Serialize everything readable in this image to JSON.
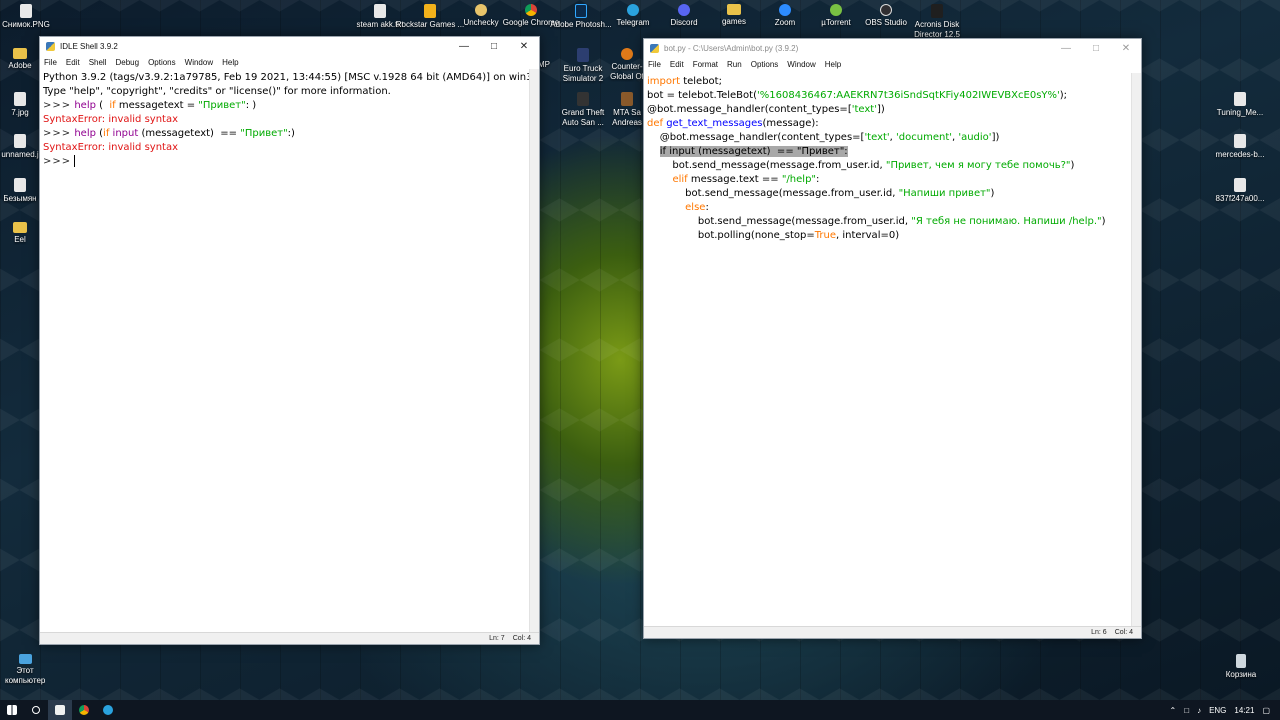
{
  "desktop_top": [
    {
      "label": "Снимок.PNG"
    },
    {
      "label": "steam akk.txt"
    },
    {
      "label": "Rockstar Games ..."
    },
    {
      "label": "Unchecky"
    },
    {
      "label": "Google Chrome"
    },
    {
      "label": "Adobe Photosh..."
    },
    {
      "label": "Telegram"
    },
    {
      "label": "Discord"
    },
    {
      "label": "games"
    },
    {
      "label": "Zoom"
    },
    {
      "label": "µTorrent"
    },
    {
      "label": "OBS Studio"
    },
    {
      "label": "Acronis Disk Director 12.5"
    }
  ],
  "desktop_left": [
    {
      "label": "Adobe"
    },
    {
      "label": "7.jpg"
    },
    {
      "label": "unnamed.j"
    },
    {
      "label": "Безымян"
    },
    {
      "label": "Eel"
    }
  ],
  "desktop_mid": [
    {
      "label": "MP"
    },
    {
      "label": "Euro Truck Simulator 2"
    },
    {
      "label": "Counter- Global Of"
    },
    {
      "label": "Grand Theft Auto San ..."
    },
    {
      "label": "MTA Sa Andreas"
    }
  ],
  "desktop_right": [
    {
      "label": "Tuning_Me..."
    },
    {
      "label": "mercedes-b..."
    },
    {
      "label": "837f247a00..."
    }
  ],
  "desktop_bottom": {
    "this_pc": "Этот компьютер",
    "recycle": "Корзина"
  },
  "shell": {
    "title": "IDLE Shell 3.9.2",
    "menu": [
      "File",
      "Edit",
      "Shell",
      "Debug",
      "Options",
      "Window",
      "Help"
    ],
    "banner1": "Python 3.9.2 (tags/v3.9.2:1a79785, Feb 19 2021, 13:44:55) [MSC v.1928 64 bit (AMD64)] on win32",
    "banner2": "Type \"help\", \"copyright\", \"credits\" or \"license()\" for more information.",
    "prompt": ">>>",
    "cmd1_a": "help",
    "cmd1_b": " (  ",
    "cmd1_c": "if",
    "cmd1_d": " messagetext = ",
    "cmd1_e": "\"Привет\"",
    "cmd1_f": ": )",
    "err_name": "SyntaxError",
    "err_msg": ": invalid syntax",
    "cmd2_a": "help",
    "cmd2_b": " (",
    "cmd2_c": "if",
    "cmd2_d": " ",
    "cmd2_e": "input",
    "cmd2_f": " (messagetext)  == ",
    "cmd2_g": "\"Привет\"",
    "cmd2_h": ":)",
    "status_ln": "Ln: 7",
    "status_col": "Col: 4"
  },
  "editor": {
    "title": "bot.py - C:\\Users\\Admin\\bot.py (3.9.2)",
    "menu": [
      "File",
      "Edit",
      "Format",
      "Run",
      "Options",
      "Window",
      "Help"
    ],
    "l1_kw": "import",
    "l1_rest": " telebot;",
    "l2_a": "bot = telebot.TeleBot(",
    "l2_str": "'%1608436467:AAEKRN7t36iSndSqtKFiy402IWEVBXcE0sY%'",
    "l2_b": ");",
    "l3_a": "@bot.message_handler(content_types=[",
    "l3_str": "'text'",
    "l3_b": "])",
    "l4_kw": "def",
    "l4_def": " get_text_messages",
    "l4_rest": "(message):",
    "l5_a": "    @bot.message_handler(content_types=[",
    "l5_s1": "'text'",
    "l5_c1": ", ",
    "l5_s2": "'document'",
    "l5_c2": ", ",
    "l5_s3": "'audio'",
    "l5_b": "])",
    "l6_indent": "    ",
    "l6_hl": "if input (messagetext)  == \"Привет\":",
    "l7_a": "        bot.send_message(message.from_user.id, ",
    "l7_str": "\"Привет, чем я могу тебе помочь?\"",
    "l7_b": ")",
    "l8_indent": "        ",
    "l8_kw": "elif",
    "l8_a": " message.text == ",
    "l8_str": "\"/help\"",
    "l8_b": ":",
    "l9_a": "            bot.send_message(message.from_user.id, ",
    "l9_str": "\"Напиши привет\"",
    "l9_b": ")",
    "l10_indent": "            ",
    "l10_kw": "else",
    "l10_b": ":",
    "l11_a": "                bot.send_message(message.from_user.id, ",
    "l11_str": "\"Я тебя не понимаю. Напиши /help.\"",
    "l11_b": ")",
    "l12_a": "                bot.polling(none_stop=",
    "l12_kw": "True",
    "l12_b": ", interval=0)",
    "status_ln": "Ln: 6",
    "status_col": "Col: 4"
  },
  "taskbar": {
    "lang": "ENG",
    "time": "14:21"
  }
}
